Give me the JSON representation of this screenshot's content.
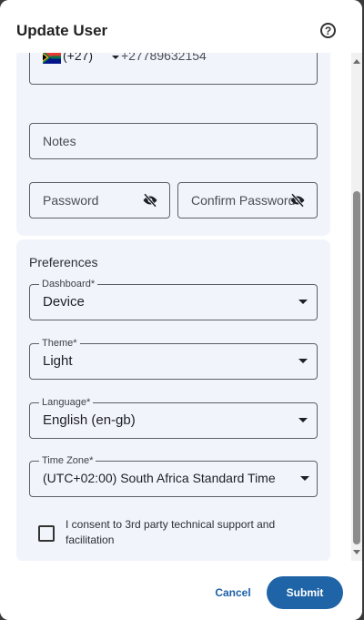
{
  "dialog": {
    "title": "Update User",
    "help_icon": "help-circle-icon"
  },
  "contact": {
    "phone": {
      "country_flag": "south-africa-flag-icon",
      "dial_code": "(+27)",
      "number": "+27789632154"
    },
    "notes": {
      "placeholder": "Notes",
      "value": ""
    },
    "password": {
      "placeholder": "Password",
      "icon": "eye-off-icon"
    },
    "confirm_password": {
      "placeholder": "Confirm Password",
      "icon": "eye-off-icon"
    }
  },
  "preferences": {
    "title": "Preferences",
    "dashboard": {
      "label": "Dashboard*",
      "value": "Device"
    },
    "theme": {
      "label": "Theme*",
      "value": "Light"
    },
    "language": {
      "label": "Language*",
      "value": "English (en-gb)"
    },
    "time_zone": {
      "label": "Time Zone*",
      "value": "(UTC+02:00) South Africa Standard Time"
    },
    "consent": {
      "label": "I consent to 3rd party technical support and facilitation",
      "checked": false
    }
  },
  "footer": {
    "cancel_label": "Cancel",
    "submit_label": "Submit"
  },
  "colors": {
    "primary": "#1f64a6",
    "card_background": "#f2f4fb",
    "field_border": "#5e6068"
  }
}
